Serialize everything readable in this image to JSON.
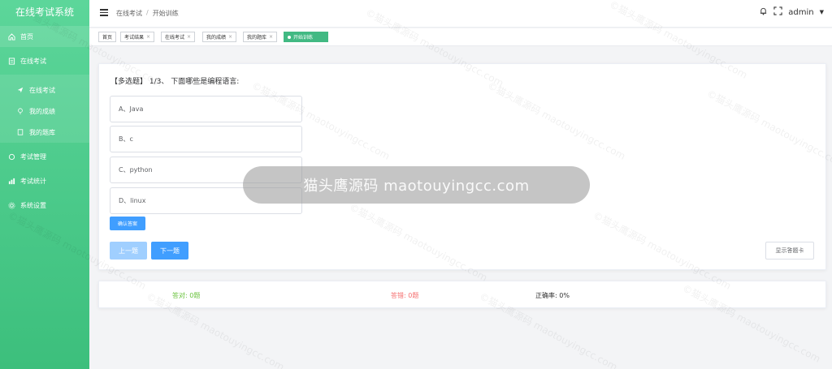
{
  "app": {
    "title": "在线考试系统"
  },
  "sidebar": {
    "items": [
      {
        "label": "首页",
        "icon": "home-icon"
      },
      {
        "label": "在线考试",
        "icon": "exam-icon"
      },
      {
        "label": "在线考试",
        "icon": "send-icon"
      },
      {
        "label": "我的成绩",
        "icon": "pin-icon"
      },
      {
        "label": "我的题库",
        "icon": "book-icon"
      },
      {
        "label": "考试管理",
        "icon": "settings-icon"
      },
      {
        "label": "考试统计",
        "icon": "chart-icon"
      },
      {
        "label": "系统设置",
        "icon": "gear-icon"
      }
    ]
  },
  "header": {
    "breadcrumb": [
      "在线考试",
      "开始训练"
    ],
    "separator": "/",
    "user": "admin"
  },
  "tags": [
    {
      "label": "首页",
      "closable": false,
      "active": false
    },
    {
      "label": "考试结果",
      "closable": true,
      "active": false
    },
    {
      "label": "在线考试",
      "closable": true,
      "active": false
    },
    {
      "label": "我的成绩",
      "closable": true,
      "active": false
    },
    {
      "label": "我的题库",
      "closable": true,
      "active": false
    },
    {
      "label": "开始训练",
      "closable": false,
      "active": true
    }
  ],
  "question": {
    "title": "【多选题】 1/3、 下面哪些是编程语言:",
    "options": [
      "A、Java",
      "B、c",
      "C、python",
      "D、linux"
    ]
  },
  "buttons": {
    "confirm": "确认答案",
    "prev": "上一题",
    "next": "下一题",
    "show_card": "显示答题卡"
  },
  "stats": {
    "correct": "答对: 0题",
    "wrong": "答错: 0题",
    "accuracy": "正确率: 0%"
  },
  "watermark": {
    "text": "©猫头鹰源码 maotouyingcc.com",
    "banner": "猫头鹰源码 maotouyingcc.com"
  },
  "colors": {
    "sidebar": "#4ccb8a",
    "primary": "#409eff",
    "active_tag": "#42b983",
    "success": "#67c23a",
    "danger": "#f56c6c"
  }
}
